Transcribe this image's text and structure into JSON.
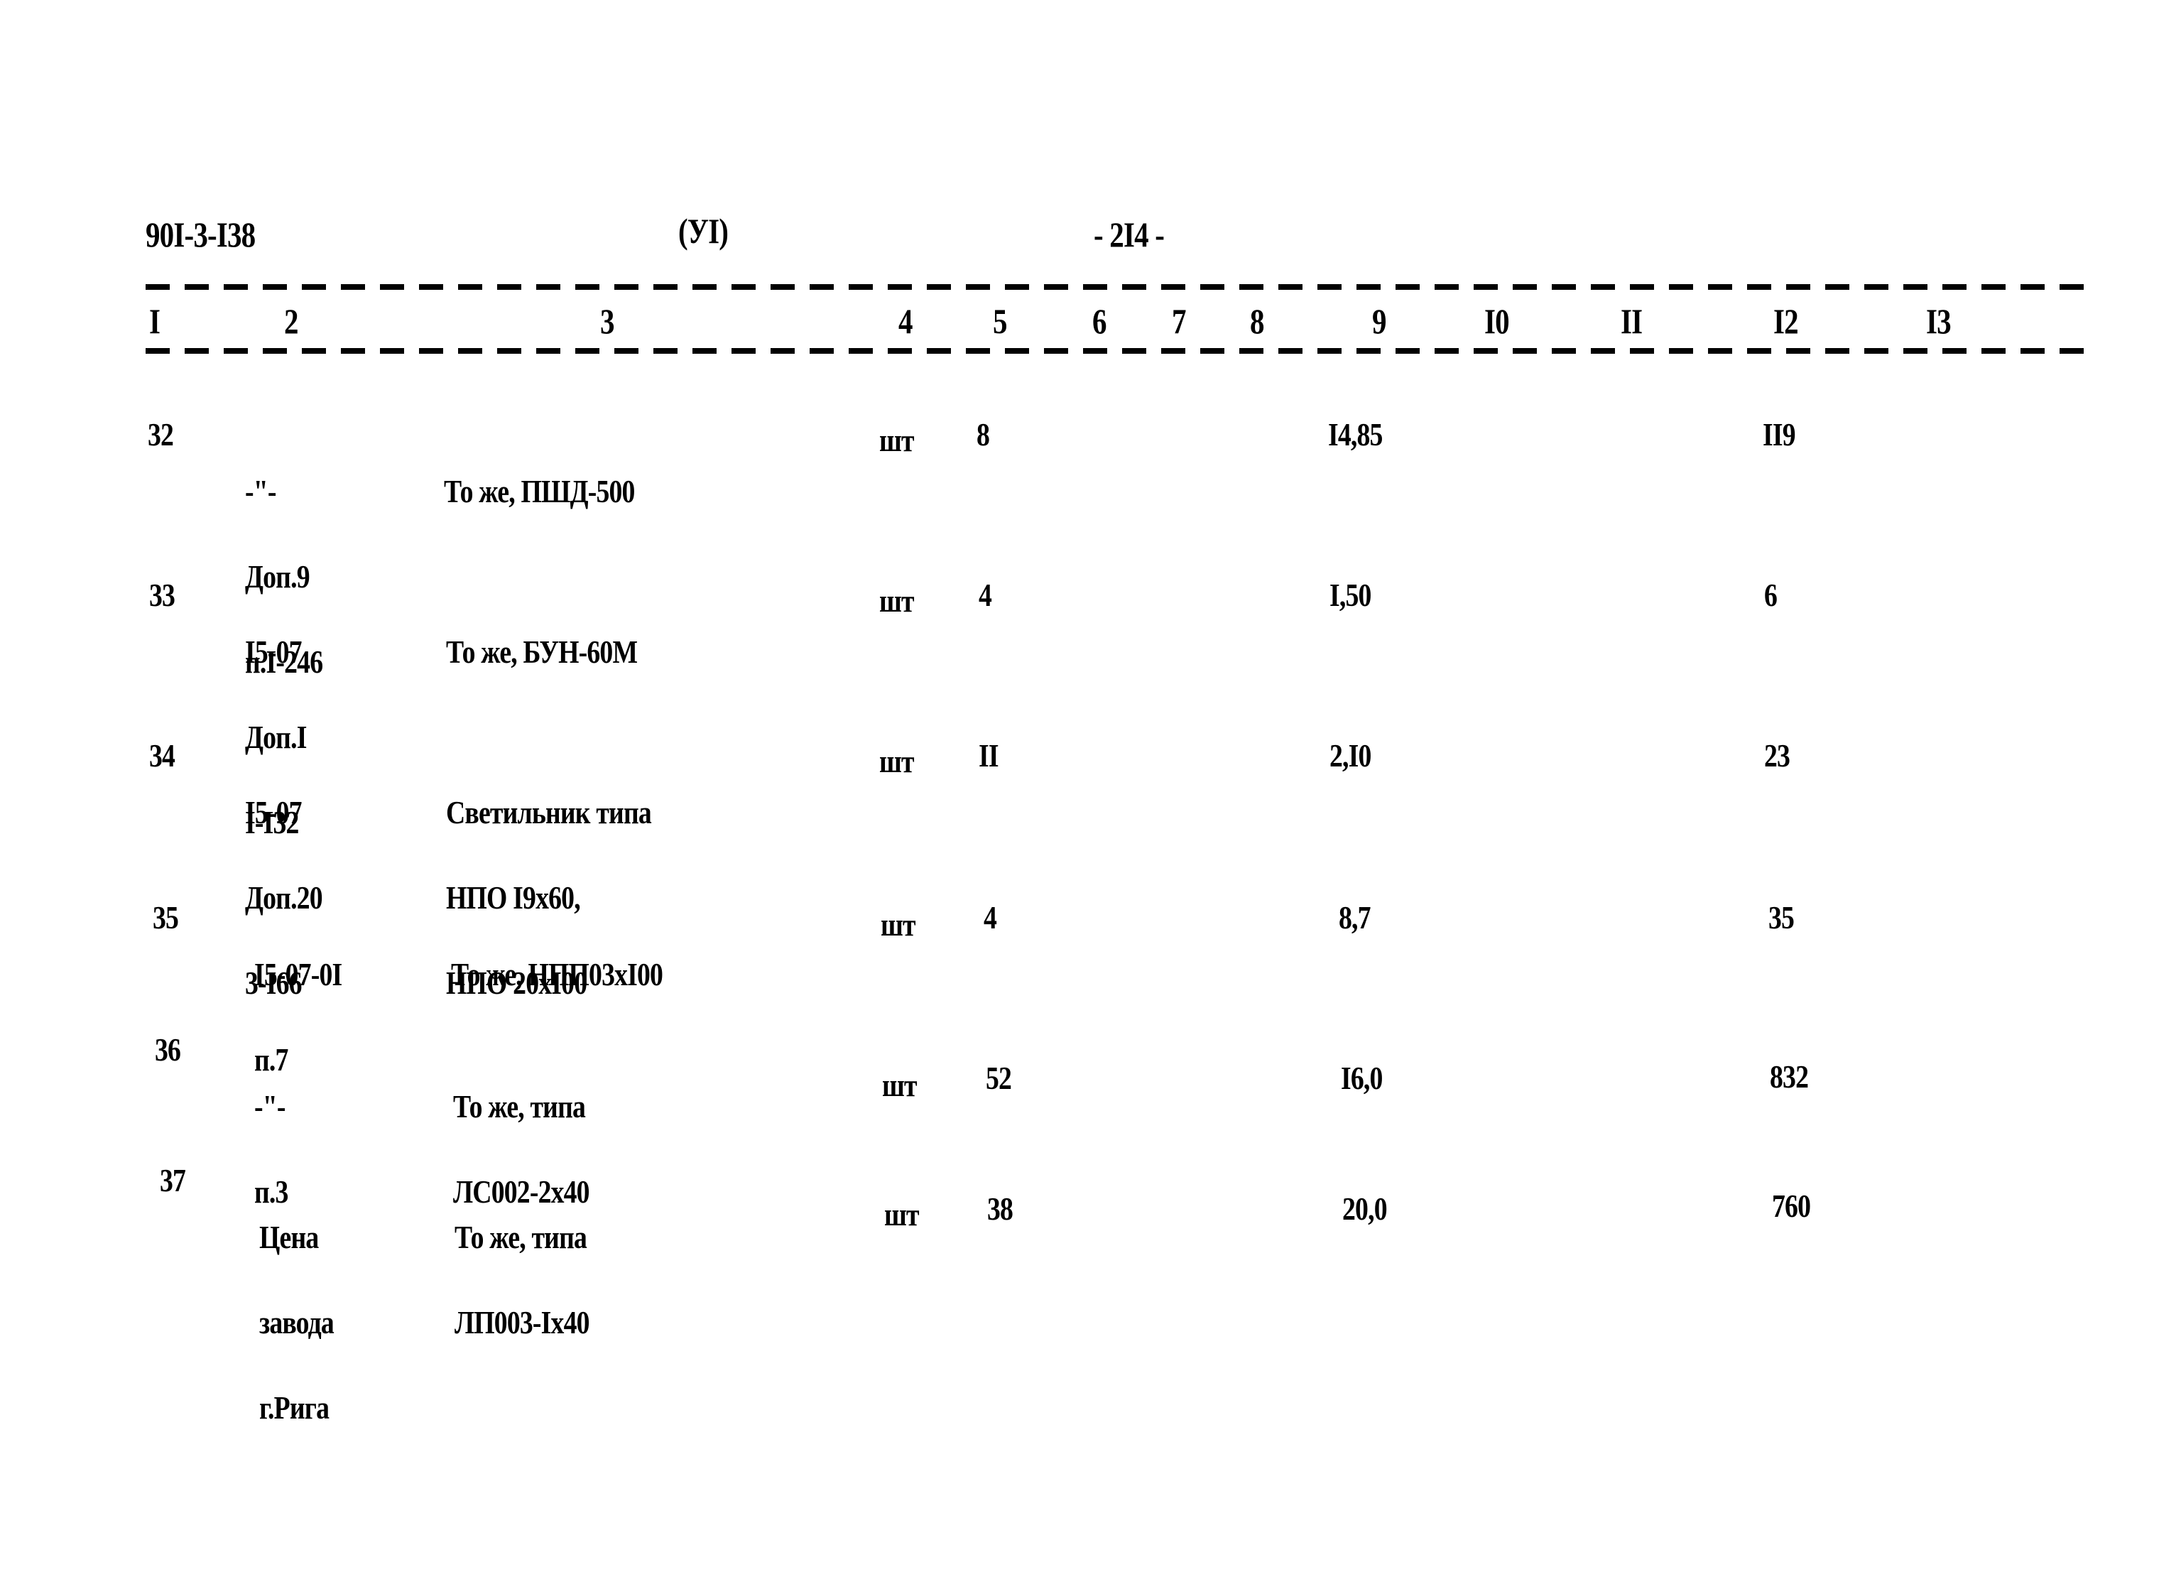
{
  "header": {
    "doc_code": "90I-3-I38",
    "section": "(УI)",
    "page_number": "- 2I4 -"
  },
  "columns": [
    "I",
    "2",
    "3",
    "4",
    "5",
    "6",
    "7",
    "8",
    "9",
    "I0",
    "II",
    "I2",
    "I3"
  ],
  "rows": [
    {
      "num": "32",
      "ref": [
        "-\"-",
        "Доп.9",
        "п.I-246"
      ],
      "name": [
        "То же, ПШД-500"
      ],
      "unit": "шт",
      "qty": "8",
      "price": "I4,85",
      "total": "II9"
    },
    {
      "num": "33",
      "ref": [
        "I5-07",
        "Доп.I",
        "I-I32"
      ],
      "name": [
        "То же, БУН-60М"
      ],
      "unit": "шт",
      "qty": "4",
      "price": "I,50",
      "total": "6"
    },
    {
      "num": "34",
      "ref": [
        "I5-07",
        "Доп.20",
        "3-I66"
      ],
      "name": [
        "Светильник типа",
        "НПО I9х60,",
        "НПО 20хI00"
      ],
      "unit": "шт",
      "qty": "II",
      "price": "2,I0",
      "total": "23"
    },
    {
      "num": "35",
      "ref": [
        "I5-07-0I",
        "п.7"
      ],
      "name": [
        "То же, НПП03хI00"
      ],
      "unit": "шт",
      "qty": "4",
      "price": "8,7",
      "total": "35"
    },
    {
      "num": "36",
      "ref": [
        "-\"-",
        "п.3"
      ],
      "name": [
        "То же, типа",
        "ЛС002-2х40"
      ],
      "unit": "шт",
      "qty": "52",
      "price": "I6,0",
      "total": "832"
    },
    {
      "num": "37",
      "ref": [
        "Цена",
        "завода",
        "г.Рига"
      ],
      "name": [
        "То же, типа",
        "ЛП003-Iх40"
      ],
      "unit": "шт",
      "qty": "38",
      "price": "20,0",
      "total": "760"
    }
  ]
}
